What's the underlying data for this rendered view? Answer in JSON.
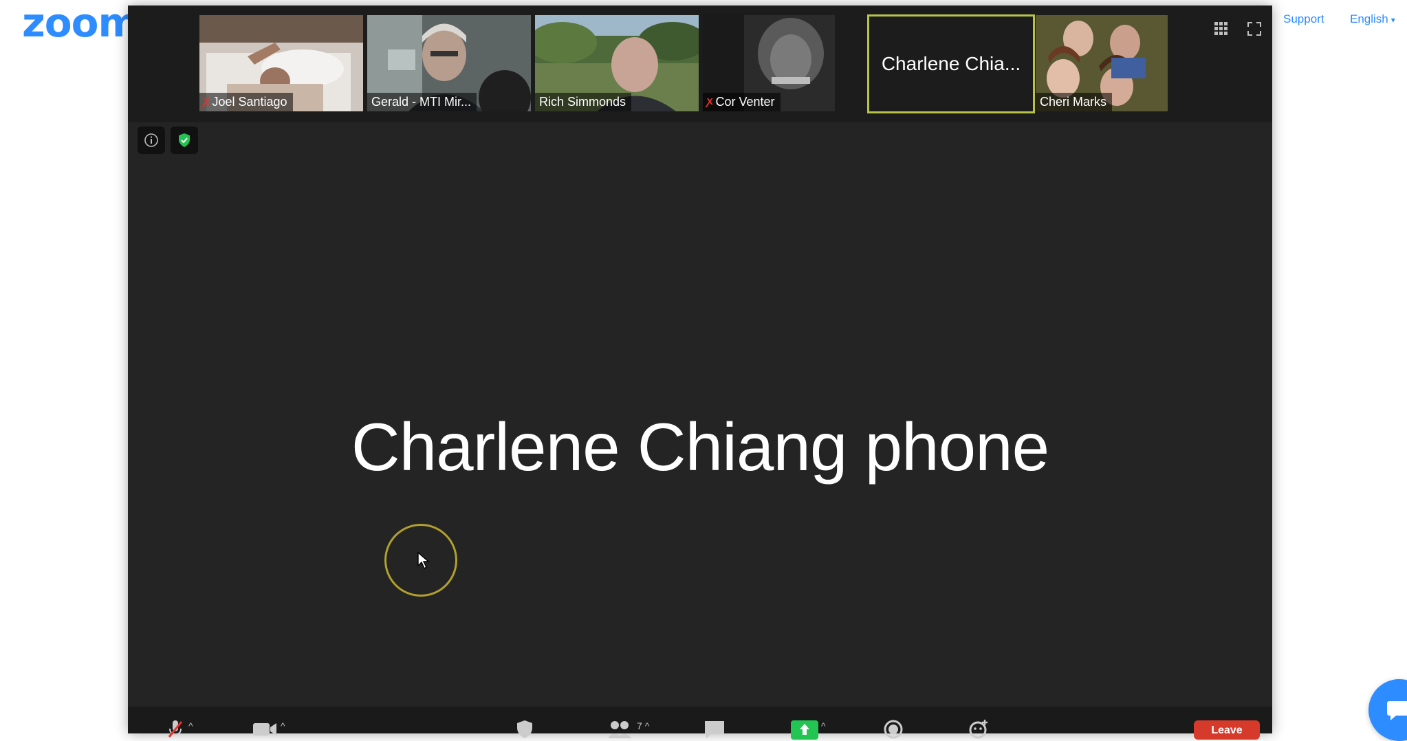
{
  "background_page": {
    "logo_text": "zoom",
    "links": {
      "support": "Support",
      "language": "English"
    },
    "brand_color": "#2D8CFF"
  },
  "gallery": {
    "participants": [
      {
        "name": "Joel Santiago",
        "muted": true
      },
      {
        "name": "Gerald - MTI Mir...",
        "muted": false
      },
      {
        "name": "Rich Simmonds",
        "muted": false
      },
      {
        "name": "Cor Venter",
        "muted": true
      },
      {
        "name": "Charlene Chia...",
        "muted": false,
        "active_speaker": true,
        "video_off": true
      },
      {
        "name": "Cheri Marks",
        "muted": false
      }
    ],
    "view_controls": [
      "grid-view-icon",
      "fullscreen-icon"
    ]
  },
  "main_view": {
    "speaker_name": "Charlene Chiang phone",
    "security_badge_color": "#23c552"
  },
  "toolbar": {
    "participants_count": "7",
    "leave_label": "Leave",
    "share_color": "#23c552",
    "leave_color": "#d53a2a"
  }
}
